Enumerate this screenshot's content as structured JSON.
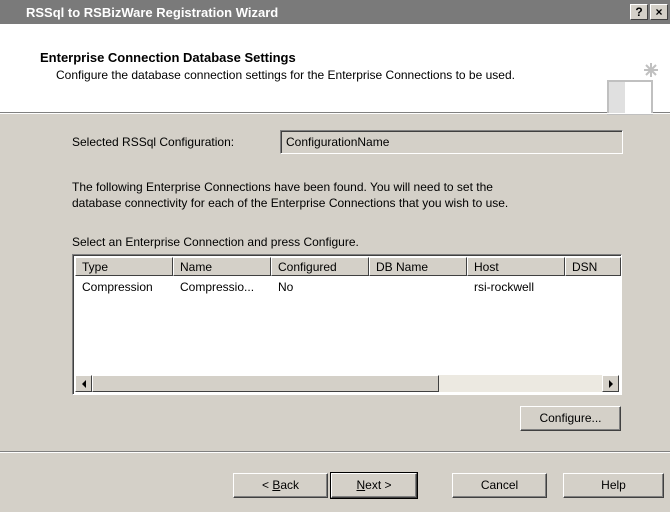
{
  "window": {
    "title": "RSSql to RSBizWare Registration Wizard",
    "help_button": "?",
    "close_button": "×"
  },
  "header": {
    "title": "Enterprise Connection Database Settings",
    "subtitle": "Configure the database connection settings for the Enterprise Connections to be used."
  },
  "config": {
    "label": "Selected RSSql Configuration:",
    "value": "ConfigurationName"
  },
  "instructions": {
    "line1": "The following Enterprise Connections have been found. You will need to set the",
    "line2": "database connectivity for each of the Enterprise Connections that you wish to use.",
    "select_prompt": "Select an Enterprise Connection and press Configure."
  },
  "table": {
    "columns": [
      "Type",
      "Name",
      "Configured",
      "DB Name",
      "Host",
      "DSN"
    ],
    "rows": [
      [
        "Compression",
        "Compressio...",
        "No",
        "",
        "rsi-rockwell",
        ""
      ]
    ]
  },
  "buttons": {
    "configure": "Configure...",
    "back_prefix": "< ",
    "back_key": "B",
    "back_rest": "ack",
    "next_key": "N",
    "next_rest": "ext >",
    "cancel": "Cancel",
    "help": "Help"
  }
}
